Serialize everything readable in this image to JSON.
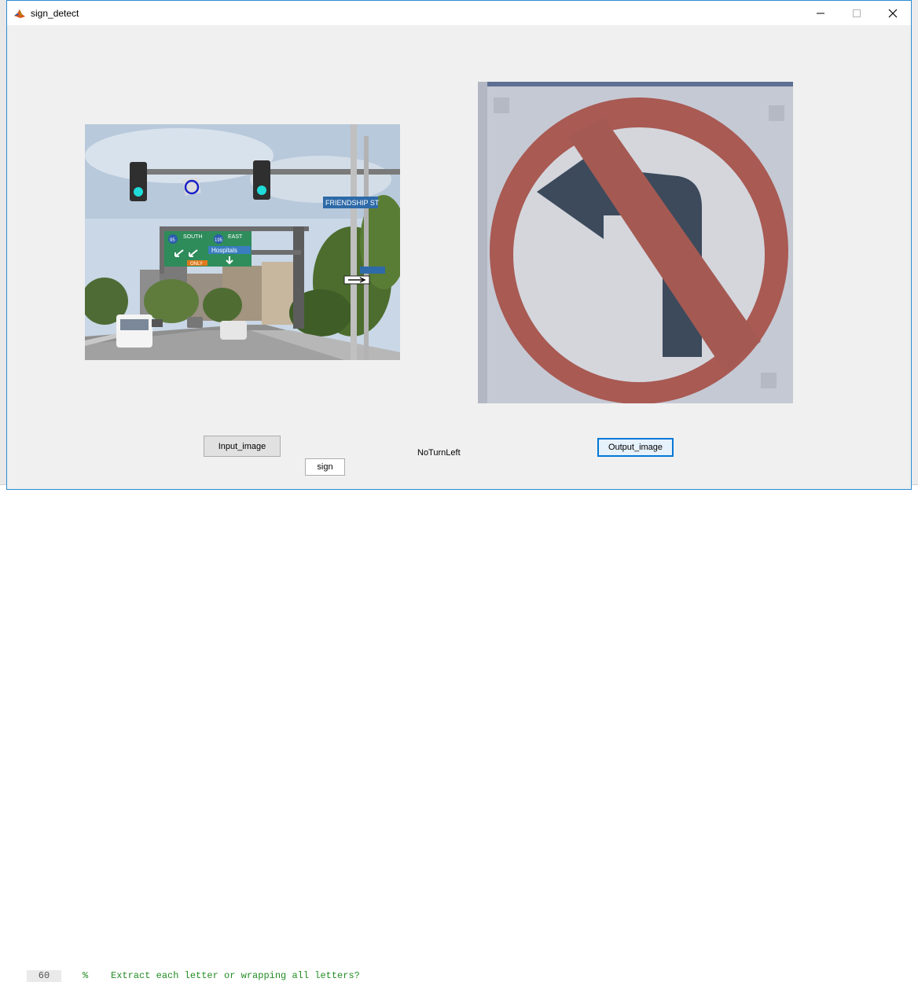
{
  "window": {
    "title": "sign_detect",
    "controls": {
      "minimize": "—",
      "maximize": "☐",
      "close": "✕"
    }
  },
  "axes": {
    "input_image": {
      "description_icon": "street-scene-image",
      "road_signs": {
        "overhead_sign_left": "SOUTH",
        "overhead_sign_right": "EAST",
        "overhead_sign_hospitals": "Hospitals",
        "overhead_sign_only": "ONLY",
        "interstate_left": "95",
        "interstate_right": "195",
        "street_sign": "FRIENDSHIP ST"
      }
    },
    "output_image": {
      "description_icon": "no-left-turn-sign-image"
    }
  },
  "controls": {
    "input_button": "Input_image",
    "output_button": "Output_image",
    "sign_button": "sign",
    "result_label": "NoTurnLeft"
  },
  "background": {
    "line_number": "60",
    "code_snippet": "%    Extract each letter or wrapping all letters?"
  },
  "colors": {
    "window_bg": "#f0f0f0",
    "title_bar": "#ffffff",
    "accent_border": "#0078d7"
  }
}
